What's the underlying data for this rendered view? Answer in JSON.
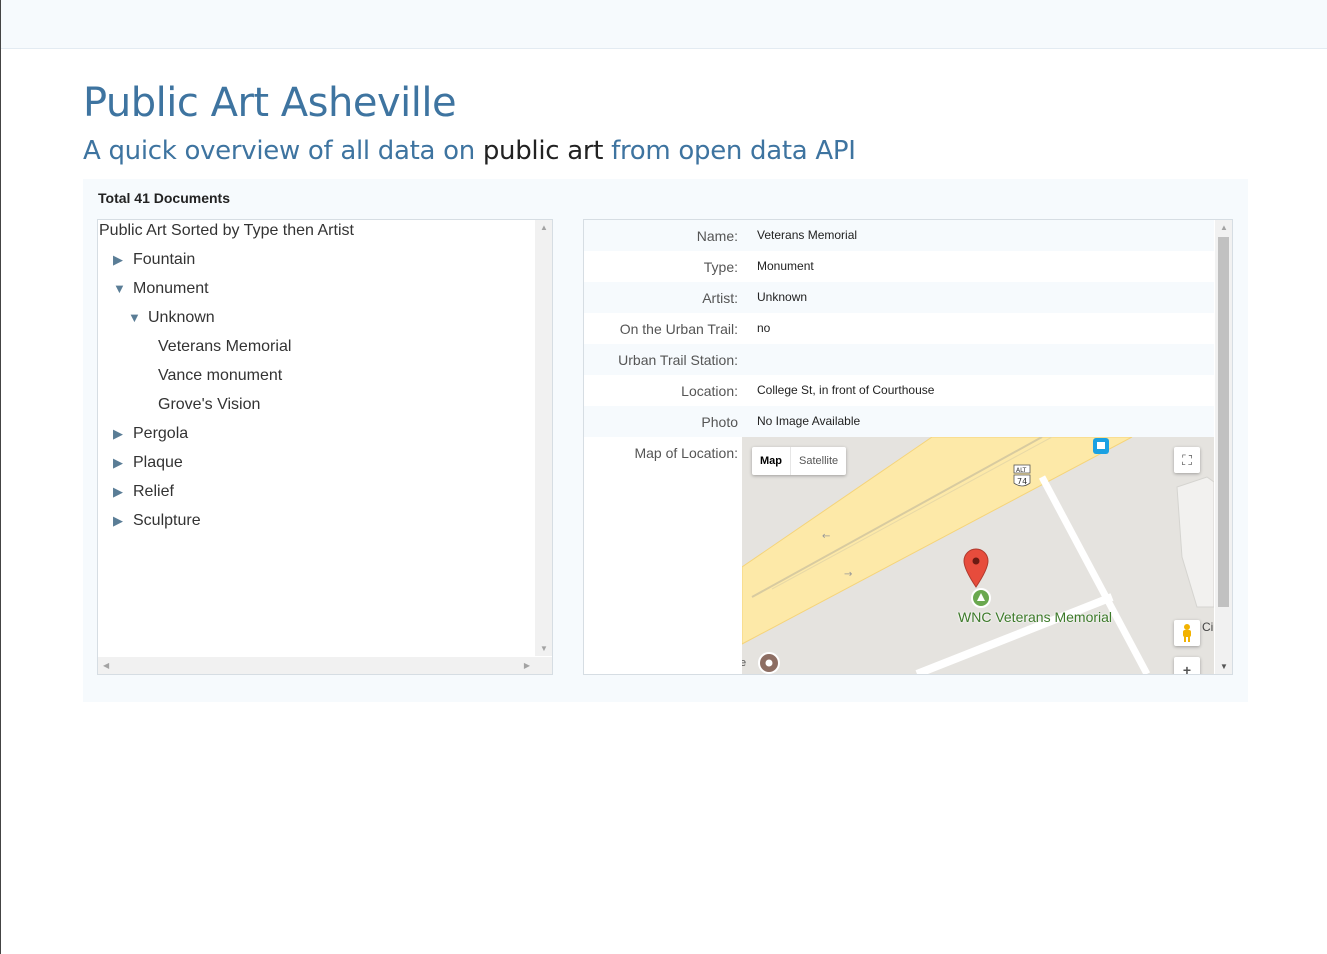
{
  "header": {
    "title": "Public Art Asheville",
    "subtitle_before": "A quick overview of all data on ",
    "subtitle_highlight": "public art",
    "subtitle_after": " from open data API"
  },
  "summary": {
    "total": "Total 41 Documents"
  },
  "tree": {
    "root": "Public Art Sorted by Type then Artist",
    "items": [
      {
        "label": "Fountain",
        "level": 1,
        "state": "collapsed"
      },
      {
        "label": "Monument",
        "level": 1,
        "state": "expanded"
      },
      {
        "label": "Unknown",
        "level": 2,
        "state": "expanded"
      },
      {
        "label": "Veterans Memorial",
        "level": 3,
        "state": "leaf"
      },
      {
        "label": "Vance monument",
        "level": 3,
        "state": "leaf"
      },
      {
        "label": "Grove's Vision",
        "level": 3,
        "state": "leaf"
      },
      {
        "label": "Pergola",
        "level": 1,
        "state": "collapsed"
      },
      {
        "label": "Plaque",
        "level": 1,
        "state": "collapsed"
      },
      {
        "label": "Relief",
        "level": 1,
        "state": "collapsed"
      },
      {
        "label": "Sculpture",
        "level": 1,
        "state": "collapsed"
      }
    ]
  },
  "details": {
    "rows": [
      {
        "label": "Name:",
        "value": "Veterans Memorial"
      },
      {
        "label": "Type:",
        "value": "Monument"
      },
      {
        "label": "Artist:",
        "value": "Unknown"
      },
      {
        "label": "On the Urban Trail:",
        "value": "no"
      },
      {
        "label": "Urban Trail Station:",
        "value": ""
      },
      {
        "label": "Location:",
        "value": "College St, in front of Courthouse"
      },
      {
        "label": "Photo",
        "value": "No Image Available"
      },
      {
        "label": "Map of Location:",
        "value": ""
      }
    ]
  },
  "map": {
    "type_map": "Map",
    "type_satellite": "Satellite",
    "marker_label": "WNC Veterans Memorial",
    "shield_top": "ALT",
    "shield_num": "74",
    "edge_text": "Ci",
    "zoom_in": "+",
    "fullscreen_icon": "fullscreen-icon",
    "pegman_icon": "pegman-icon",
    "marker_icon": "map-marker-icon",
    "colors": {
      "road": "#fde9a8",
      "road_edge": "#f5d47a",
      "ground": "#e5e3df",
      "marker": "#e74c3c",
      "park": "#6aa84f"
    }
  },
  "colors": {
    "accent": "#3e74a0",
    "panel_bg": "#f6fafd"
  }
}
